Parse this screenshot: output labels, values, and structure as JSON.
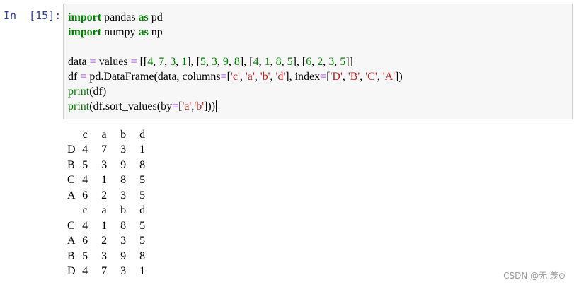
{
  "prompt": "In  [15]:",
  "code": {
    "line1": {
      "kw1": "import",
      "mod": " pandas ",
      "kw2": "as",
      "alias": " pd"
    },
    "line2": {
      "kw1": "import",
      "mod": " numpy ",
      "kw2": "as",
      "alias": " np"
    },
    "line4": {
      "pre": "data ",
      "eq1": "=",
      "mid": " values ",
      "eq2": "=",
      "sp": " ",
      "b0": "[[",
      "n1": "4",
      "c1": ", ",
      "n2": "7",
      "c2": ", ",
      "n3": "3",
      "c3": ", ",
      "n4": "1",
      "b1": "], [",
      "n5": "5",
      "c5": ", ",
      "n6": "3",
      "c6": ", ",
      "n7": "9",
      "c7": ", ",
      "n8": "8",
      "b2": "], [",
      "n9": "4",
      "c9": ", ",
      "n10": "1",
      "c10": ", ",
      "n11": "8",
      "c11": ", ",
      "n12": "5",
      "b3": "], [",
      "n13": "6",
      "c13": ", ",
      "n14": "2",
      "c14": ", ",
      "n15": "3",
      "c15": ", ",
      "n16": "5",
      "b4": "]]"
    },
    "line5": {
      "pre": "df ",
      "eq1": "=",
      "mid": " pd.DataFrame(data, columns",
      "eq2": "=",
      "o1": "[",
      "s1": "'c'",
      "k1": ", ",
      "s2": "'a'",
      "k2": ", ",
      "s3": "'b'",
      "k3": ", ",
      "s4": "'d'",
      "mid2": "], index",
      "eq3": "=",
      "o2": "[",
      "s5": "'D'",
      "k5": ", ",
      "s6": "'B'",
      "k6": ", ",
      "s7": "'C'",
      "k7": ", ",
      "s8": "'A'",
      "end": "])"
    },
    "line6": {
      "fn": "print",
      "rest": "(df)"
    },
    "line7": {
      "fn": "print",
      "a": "(df.sort_values(by",
      "eq": "=",
      "o": "[",
      "s1": "'a'",
      "k": ",",
      "s2": "'b'",
      "end": "]))"
    }
  },
  "output": {
    "table1": {
      "columns": [
        "c",
        "a",
        "b",
        "d"
      ],
      "rows": [
        {
          "index": "D",
          "values": [
            "4",
            "7",
            "3",
            "1"
          ]
        },
        {
          "index": "B",
          "values": [
            "5",
            "3",
            "9",
            "8"
          ]
        },
        {
          "index": "C",
          "values": [
            "4",
            "1",
            "8",
            "5"
          ]
        },
        {
          "index": "A",
          "values": [
            "6",
            "2",
            "3",
            "5"
          ]
        }
      ]
    },
    "table2": {
      "columns": [
        "c",
        "a",
        "b",
        "d"
      ],
      "rows": [
        {
          "index": "C",
          "values": [
            "4",
            "1",
            "8",
            "5"
          ]
        },
        {
          "index": "A",
          "values": [
            "6",
            "2",
            "3",
            "5"
          ]
        },
        {
          "index": "B",
          "values": [
            "5",
            "3",
            "9",
            "8"
          ]
        },
        {
          "index": "D",
          "values": [
            "4",
            "7",
            "3",
            "1"
          ]
        }
      ]
    }
  },
  "watermark": "CSDN @无 羡⊙"
}
